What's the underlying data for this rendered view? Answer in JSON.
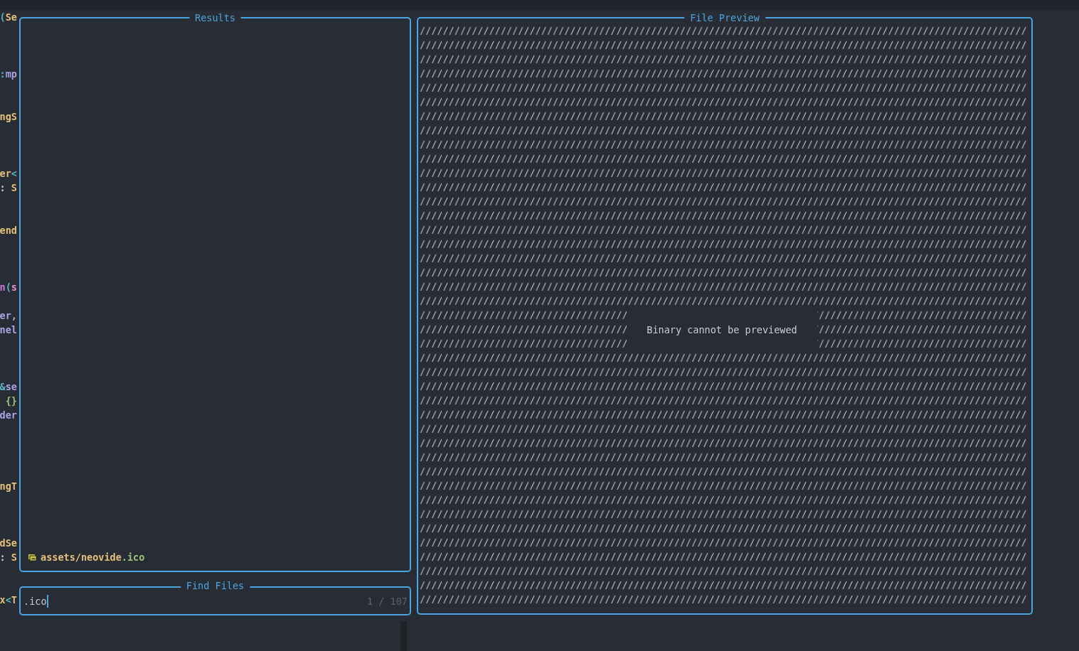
{
  "code_lines": [
    {
      "kind": "code",
      "segments": [
        {
          "text": "(",
          "kind": "punct"
        },
        {
          "text": "Se",
          "kind": "type"
        }
      ]
    },
    {
      "kind": "blank"
    },
    {
      "kind": "blank"
    },
    {
      "kind": "blank"
    },
    {
      "kind": "code",
      "segments": [
        {
          "text": ":",
          "kind": "punct"
        },
        {
          "text": "mp",
          "kind": "keyword"
        }
      ]
    },
    {
      "kind": "blank"
    },
    {
      "kind": "blank"
    },
    {
      "kind": "code",
      "segments": [
        {
          "text": "ngS",
          "kind": "type"
        }
      ]
    },
    {
      "kind": "blank"
    },
    {
      "kind": "blank"
    },
    {
      "kind": "blank"
    },
    {
      "kind": "code",
      "segments": [
        {
          "text": "er",
          "kind": "type"
        },
        {
          "text": "<",
          "kind": "punct"
        }
      ]
    },
    {
      "kind": "code",
      "segments": [
        {
          "text": ":",
          "kind": "plain"
        },
        {
          "text": " S",
          "kind": "type"
        }
      ]
    },
    {
      "kind": "blank"
    },
    {
      "kind": "blank"
    },
    {
      "kind": "code",
      "segments": [
        {
          "text": "end",
          "kind": "type"
        }
      ]
    },
    {
      "kind": "blank"
    },
    {
      "kind": "blank"
    },
    {
      "kind": "blank"
    },
    {
      "kind": "code",
      "segments": [
        {
          "text": "n",
          "kind": "function"
        },
        {
          "text": "(",
          "kind": "punct"
        },
        {
          "text": "s",
          "kind": "self"
        }
      ]
    },
    {
      "kind": "blank"
    },
    {
      "kind": "code",
      "segments": [
        {
          "text": "er,",
          "kind": "variable"
        }
      ]
    },
    {
      "kind": "code",
      "segments": [
        {
          "text": "nel",
          "kind": "variable"
        }
      ]
    },
    {
      "kind": "blank"
    },
    {
      "kind": "blank"
    },
    {
      "kind": "blank"
    },
    {
      "kind": "code",
      "segments": [
        {
          "text": "&",
          "kind": "punct"
        },
        {
          "text": "se",
          "kind": "variable"
        }
      ]
    },
    {
      "kind": "code",
      "segments": [
        {
          "text": "{}",
          "kind": "string"
        }
      ]
    },
    {
      "kind": "code",
      "segments": [
        {
          "text": "der",
          "kind": "variable"
        }
      ]
    },
    {
      "kind": "blank"
    },
    {
      "kind": "blank"
    },
    {
      "kind": "blank"
    },
    {
      "kind": "blank"
    },
    {
      "kind": "code",
      "segments": [
        {
          "text": "ngT",
          "kind": "type"
        }
      ]
    },
    {
      "kind": "blank"
    },
    {
      "kind": "blank"
    },
    {
      "kind": "blank"
    },
    {
      "kind": "code",
      "segments": [
        {
          "text": "dSe",
          "kind": "type"
        }
      ]
    },
    {
      "kind": "code",
      "segments": [
        {
          "text": ":",
          "kind": "plain"
        },
        {
          "text": " S",
          "kind": "type"
        }
      ]
    },
    {
      "kind": "blank"
    },
    {
      "kind": "blank"
    },
    {
      "kind": "code",
      "segments": [
        {
          "text": "x",
          "kind": "type"
        },
        {
          "text": "<",
          "kind": "punct"
        },
        {
          "text": "T",
          "kind": "type"
        }
      ]
    }
  ],
  "results": {
    "title": "Results",
    "items": [
      {
        "path": "assets/neovide",
        "extension": ".ico"
      }
    ]
  },
  "find_files": {
    "title": "Find Files",
    "value": ".ico",
    "counter": "1 / 107"
  },
  "preview": {
    "title": "File Preview",
    "message": "Binary cannot be previewed"
  }
}
